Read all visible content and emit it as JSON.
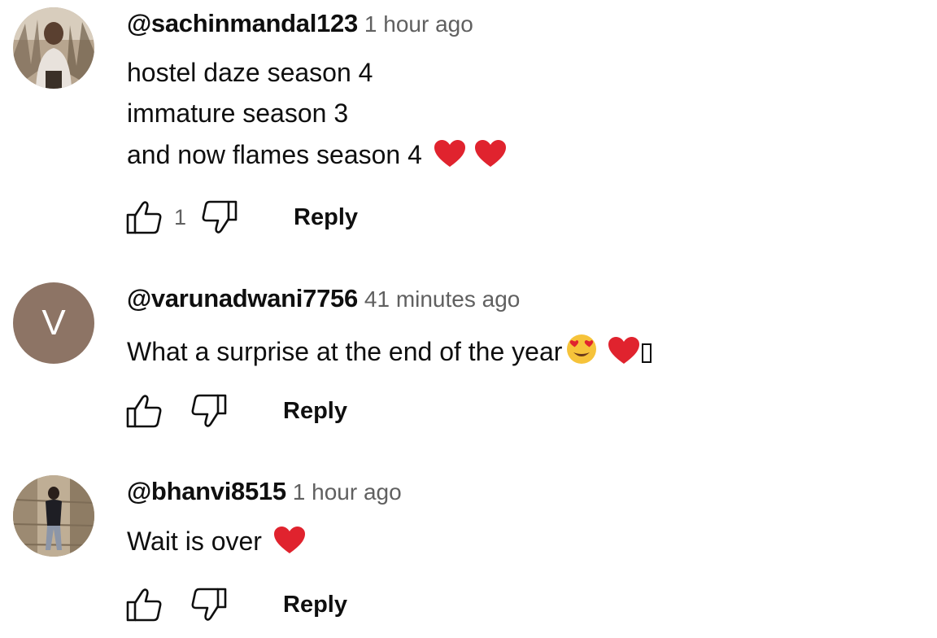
{
  "comments": [
    {
      "author": "@sachinmandal123",
      "time": "1 hour ago",
      "lines": [
        "hostel daze season 4",
        "immature season 3",
        "and now flames season 4"
      ],
      "line_emoji": [
        "",
        "",
        "heart-emoji heart-emoji"
      ],
      "like_count": "1",
      "reply_label": "Reply",
      "avatar": "photo"
    },
    {
      "author": "@varunadwani7756",
      "time": "41 minutes ago",
      "lines": [
        "What a surprise at the end of the year"
      ],
      "line_emoji": [
        "heart-eyes-emoji heart-emoji missing-glyph"
      ],
      "like_count": "",
      "reply_label": "Reply",
      "avatar": "letter",
      "avatar_letter": "V",
      "avatar_color": "#8d7465"
    },
    {
      "author": "@bhanvi8515",
      "time": "1 hour ago",
      "lines": [
        "Wait is over"
      ],
      "line_emoji": [
        "heart-emoji"
      ],
      "like_count": "",
      "reply_label": "Reply",
      "avatar": "photo"
    }
  ],
  "icons": {
    "like": "thumbs-up-icon",
    "dislike": "thumbs-down-icon"
  },
  "colors": {
    "heart": "#e0232e",
    "secondary_text": "#606060",
    "primary_text": "#0f0f0f"
  }
}
